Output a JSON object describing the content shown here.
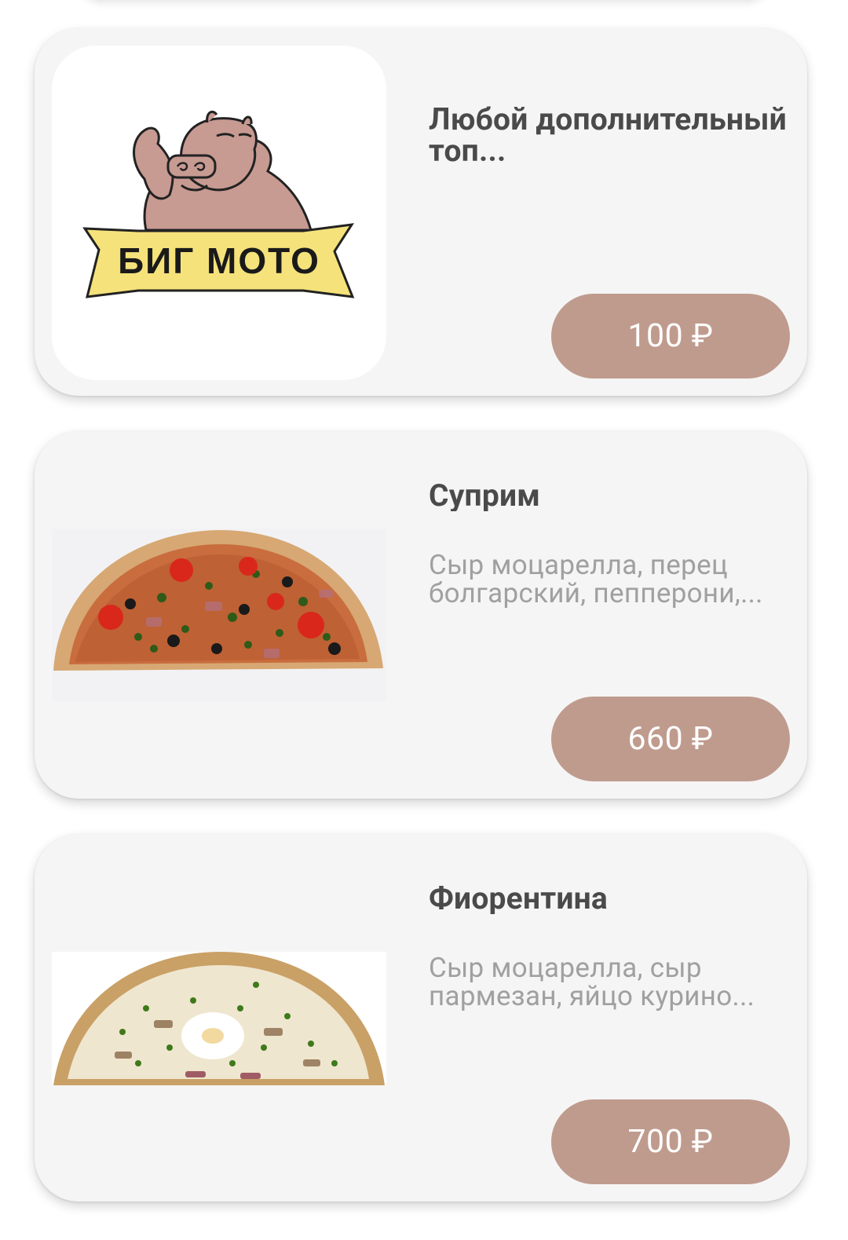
{
  "products": [
    {
      "name": "Любой дополнительный топ...",
      "description": "",
      "price": "100 ₽",
      "image": "bigmoto-logo",
      "logo_text": "БИГ МОТО"
    },
    {
      "name": "Суприм",
      "description": "Сыр моцарелла, перец болгарский, пепперони,...",
      "price": "660 ₽",
      "image": "pizza-supreme-photo"
    },
    {
      "name": "Фиорентина",
      "description": "Сыр моцарелла, сыр пармезан, яйцо курино...",
      "price": "700 ₽",
      "image": "pizza-fiorentina-photo"
    }
  ],
  "colors": {
    "card_background": "#f5f5f5",
    "price_button": "#bf9b8e",
    "title_text": "#4a4a4a",
    "description_text": "#a0a0a0",
    "logo_banner": "#f5e27a"
  }
}
